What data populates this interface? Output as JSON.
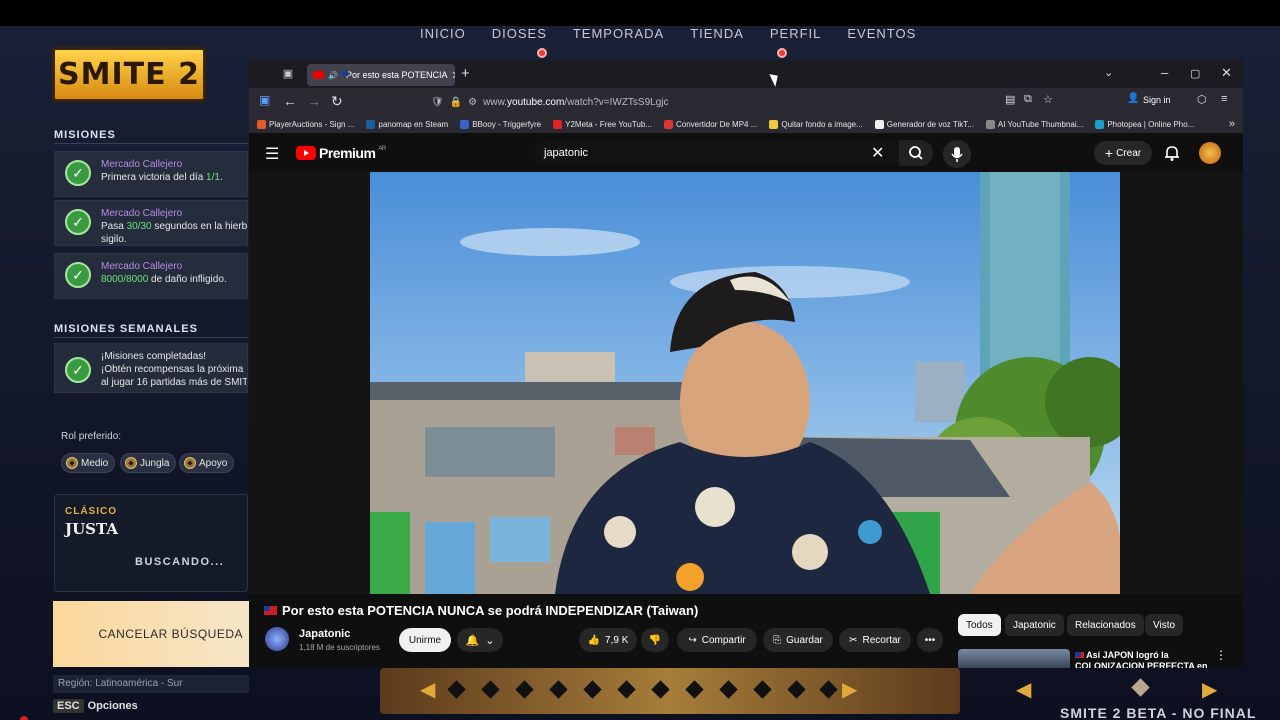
{
  "game": {
    "logo": "SMITE 2",
    "nav": [
      "INICIO",
      "DIOSES",
      "TEMPORADA",
      "TIENDA",
      "PERFIL",
      "EVENTOS"
    ],
    "missions_title": "MISIONES",
    "missions": [
      {
        "title": "Mercado Callejero",
        "desc_pre": "Primera victoria del día ",
        "desc_hl": "1/1",
        "desc_post": "."
      },
      {
        "title": "Mercado Callejero",
        "desc_pre": "Pasa ",
        "desc_hl": "30/30",
        "desc_post": " segundos en la hierba",
        "desc2": "sigilo."
      },
      {
        "title": "Mercado Callejero",
        "desc_pre": "",
        "desc_hl": "8000/8000",
        "desc_post": " de daño infligido."
      }
    ],
    "weekly_title": "MISIONES SEMANALES",
    "weekly": {
      "line1": "¡Misiones completadas!",
      "line2": "¡Obtén recompensas la próxima",
      "line3": "al jugar 16 partidas más de SMITE"
    },
    "role_label": "Rol preferido:",
    "roles": [
      "Medio",
      "Jungla",
      "Apoyo"
    ],
    "queue": {
      "type": "CLÁSICO",
      "mode": "JUSTA",
      "status": "BUSCANDO..."
    },
    "cancel": "CANCELAR BÚSQUEDA",
    "region": "Región: Latinoamérica - Sur",
    "esc_key": "ESC",
    "esc_label": "Opciones",
    "beta": "SMITE 2 BETA - NO FINAL"
  },
  "browser": {
    "tab_title": "Por esto esta POTENCIA",
    "url_prefix": "www.",
    "url_domain": "youtube.com",
    "url_path": "/watch?v=IWZTsS9Lgjc",
    "signin": "Sign in",
    "bookmarks": [
      {
        "label": "PlayerAuctions - Sign ...",
        "color": "#e25b2a"
      },
      {
        "label": "panomap en Steam",
        "color": "#1b5fa3"
      },
      {
        "label": "BBooy - Triggerfyre",
        "color": "#3a64c8"
      },
      {
        "label": "Y2Meta - Free YouTub...",
        "color": "#e02424"
      },
      {
        "label": "Convertidor De MP4 ...",
        "color": "#d83535"
      },
      {
        "label": "Quitar fondo a image...",
        "color": "#f0c93a"
      },
      {
        "label": "Generador de voz TikT...",
        "color": "#eeeeee"
      },
      {
        "label": "AI YouTube Thumbnai...",
        "color": "#888888"
      },
      {
        "label": "Photopea | Online Pho...",
        "color": "#18a0c8"
      }
    ]
  },
  "youtube": {
    "logo": "Premium",
    "region": "AR",
    "search": "japatonic",
    "create": "Crear",
    "video_title": "Por esto esta POTENCIA NUNCA se podrá INDEPENDIZAR (Taiwan)",
    "channel": "Japatonic",
    "subs": "1,18 M de suscriptores",
    "join": "Unirme",
    "likes": "7,9 K",
    "share": "Compartir",
    "save": "Guardar",
    "clip": "Recortar",
    "chips": [
      "Todos",
      "Japatonic",
      "Relacionados",
      "Visto"
    ],
    "rec_title": "Así JAPON logró la COLONIZACION PERFECTA en"
  }
}
